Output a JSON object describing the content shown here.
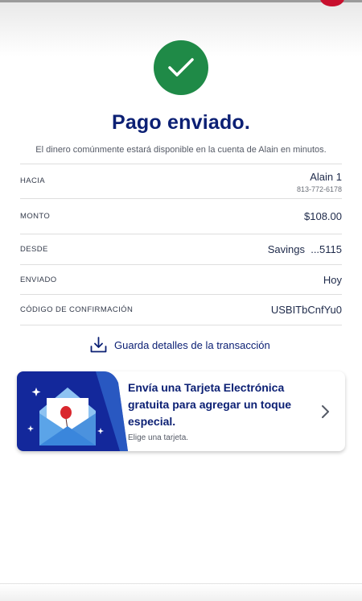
{
  "header": {
    "title": "Pago enviado.",
    "subtitle": "El dinero comúnmente estará disponible en la cuenta de Alain en minutos."
  },
  "icons": {
    "success": "checkmark-icon",
    "download": "download-icon",
    "chevron": "chevron-right-icon",
    "card_art": "envelope-balloon-illustration"
  },
  "colors": {
    "brand_navy": "#0c2074",
    "success_green": "#1f8a47",
    "card_art_blue": "#13289b"
  },
  "details": {
    "to": {
      "label": "HACIA",
      "name": "Alain 1",
      "phone": "813-772-6178"
    },
    "amount": {
      "label": "MONTO",
      "value": "$108.00"
    },
    "from": {
      "label": "DESDE",
      "value": "Savings  ...5115"
    },
    "sent": {
      "label": "ENVIADO",
      "value": "Hoy"
    },
    "confirmation": {
      "label": "CÓDIGO DE CONFIRMACIÓN",
      "value": "USBITbCnfYu0"
    }
  },
  "save_link": {
    "label": "Guarda detalles de la transacción"
  },
  "ecard": {
    "title": "Envía una Tarjeta Electrónica gratuita para agregar un toque especial.",
    "subtitle": "Elige una tarjeta."
  }
}
